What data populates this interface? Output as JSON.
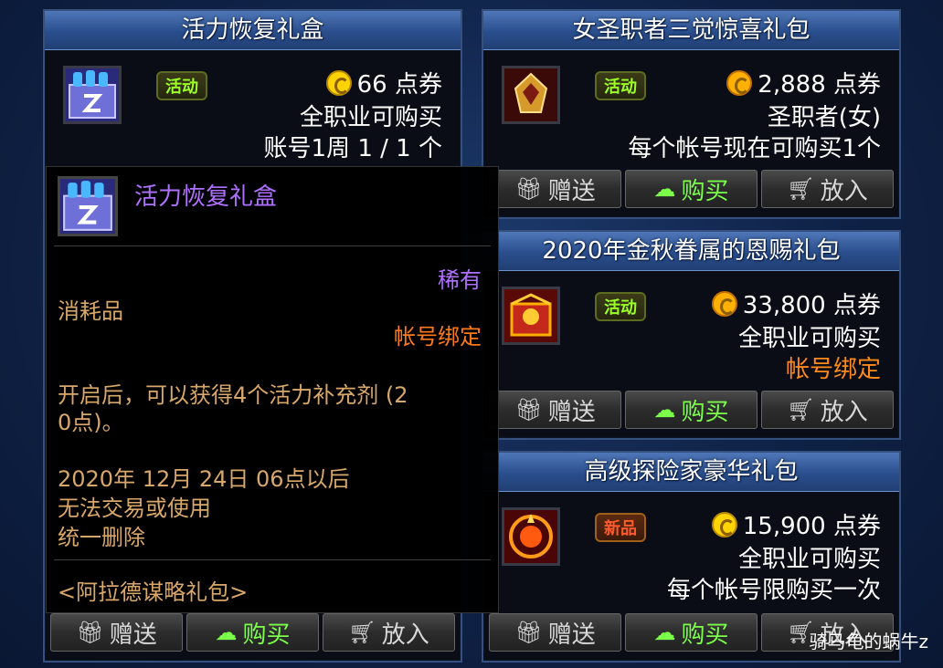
{
  "cards": [
    {
      "title": "活力恢复礼盒",
      "badge": "活动",
      "price": "66 点券",
      "lines": [
        "全职业可购买",
        "账号1周 1 / 1 个"
      ],
      "buttons": [
        "赠送",
        "购买",
        "放入"
      ]
    },
    {
      "title": "女圣职者三觉惊喜礼包",
      "badge": "活动",
      "price": "2,888 点券",
      "lines": [
        "圣职者(女)",
        "每个帐号现在可购买1个"
      ],
      "buttons": [
        "赠送",
        "购买",
        "放入"
      ]
    },
    {
      "title": "2020年金秋眷属的恩赐礼包",
      "badge": "活动",
      "price": "33,800 点券",
      "lines": [
        "全职业可购买",
        "帐号绑定"
      ],
      "buttons": [
        "赠送",
        "购买",
        "放入"
      ]
    },
    {
      "title": "高级探险家豪华礼包",
      "badge": "新品",
      "price": "15,900 点券",
      "lines": [
        "全职业可购买",
        "每个帐号限购买一次"
      ],
      "buttons": [
        "赠送",
        "购买",
        "放入"
      ]
    }
  ],
  "tooltip": {
    "name": "活力恢复礼盒",
    "rarity": "稀有",
    "type": "消耗品",
    "bind": "帐号绑定",
    "desc1": "开启后，可以获得4个活力补充剂 (2",
    "desc2": "0点)。",
    "expire1": "2020年 12月 24日 06点以后",
    "expire2": "无法交易或使用",
    "expire3": "统一删除",
    "source": "<阿拉德谋略礼包>"
  },
  "watermark": "骑马龟的蜗牛z",
  "colors": {
    "rarity": "#b070ff",
    "bind": "#ff7a1a",
    "desc": "#d8a76a",
    "buy": "#7cff4a",
    "active_badge": "#9cff2a",
    "new_badge": "#ff5a2a"
  }
}
